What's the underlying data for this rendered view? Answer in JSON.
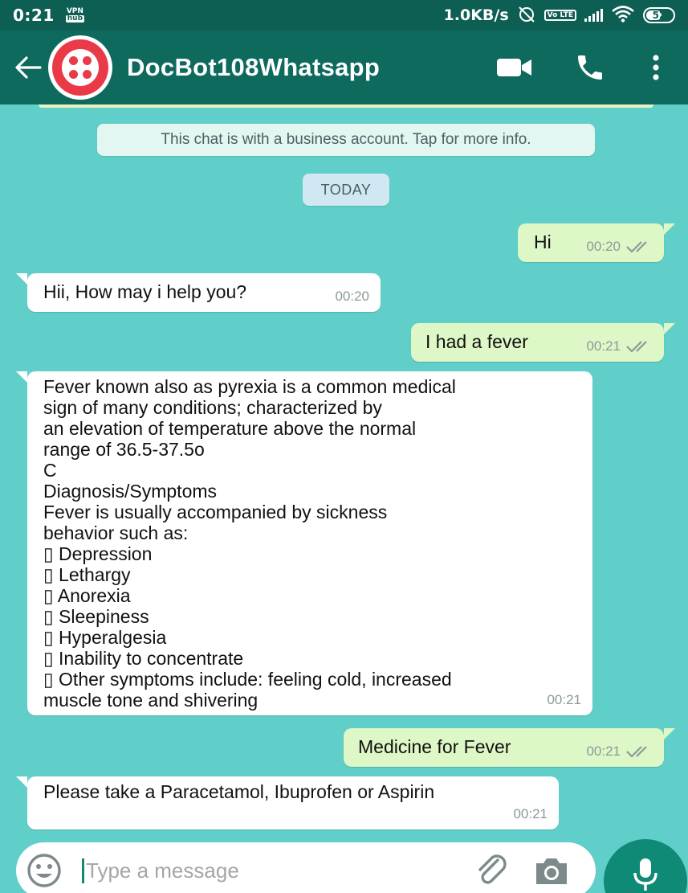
{
  "status_bar": {
    "time": "0:21",
    "vpn_top": "VPN",
    "vpn_bottom": "hub",
    "net_speed": "1.0KB/s",
    "volte": "Vo LTE",
    "battery": "52",
    "battery_level": 0.52
  },
  "header": {
    "title": "DocBot108Whatsapp",
    "icons": [
      "back-arrow-icon",
      "video-call-icon",
      "phone-icon",
      "more-options-icon"
    ]
  },
  "chat": {
    "business_notice": "This chat is with a business account. Tap for more info.",
    "date_chip": "TODAY",
    "messages": [
      {
        "dir": "out",
        "text": "Hi",
        "time": "00:20",
        "status": "read"
      },
      {
        "dir": "in",
        "text": "Hii, How may i help you?",
        "time": "00:20"
      },
      {
        "dir": "out",
        "text": "I had a fever",
        "time": "00:21",
        "status": "read"
      },
      {
        "dir": "in",
        "text": "Fever known also as pyrexia is a common medical\nsign of many conditions; characterized by\nan elevation of temperature above the normal\nrange of 36.5-37.5o\nC\nDiagnosis/Symptoms\nFever is usually accompanied by sickness\nbehavior such as:\n▯ Depression\n▯ Lethargy\n▯ Anorexia\n▯ Sleepiness\n▯ Hyperalgesia\n▯ Inability to concentrate\n▯ Other symptoms include: feeling cold, increased\nmuscle tone and shivering",
        "time": "00:21"
      },
      {
        "dir": "out",
        "text": "Medicine for Fever",
        "time": "00:21",
        "status": "read"
      },
      {
        "dir": "in",
        "text": "Please take a Paracetamol, Ibuprofen or Aspirin",
        "time": "00:21"
      }
    ]
  },
  "composer": {
    "placeholder": "Type a message",
    "value": ""
  },
  "colors": {
    "chat_bg": "#61cfc9",
    "header_bg": "#0f6a5e",
    "status_bg": "#0d5e53",
    "out_bubble": "#ddf7c6",
    "in_bubble": "#ffffff",
    "accent": "#0f8a76"
  }
}
